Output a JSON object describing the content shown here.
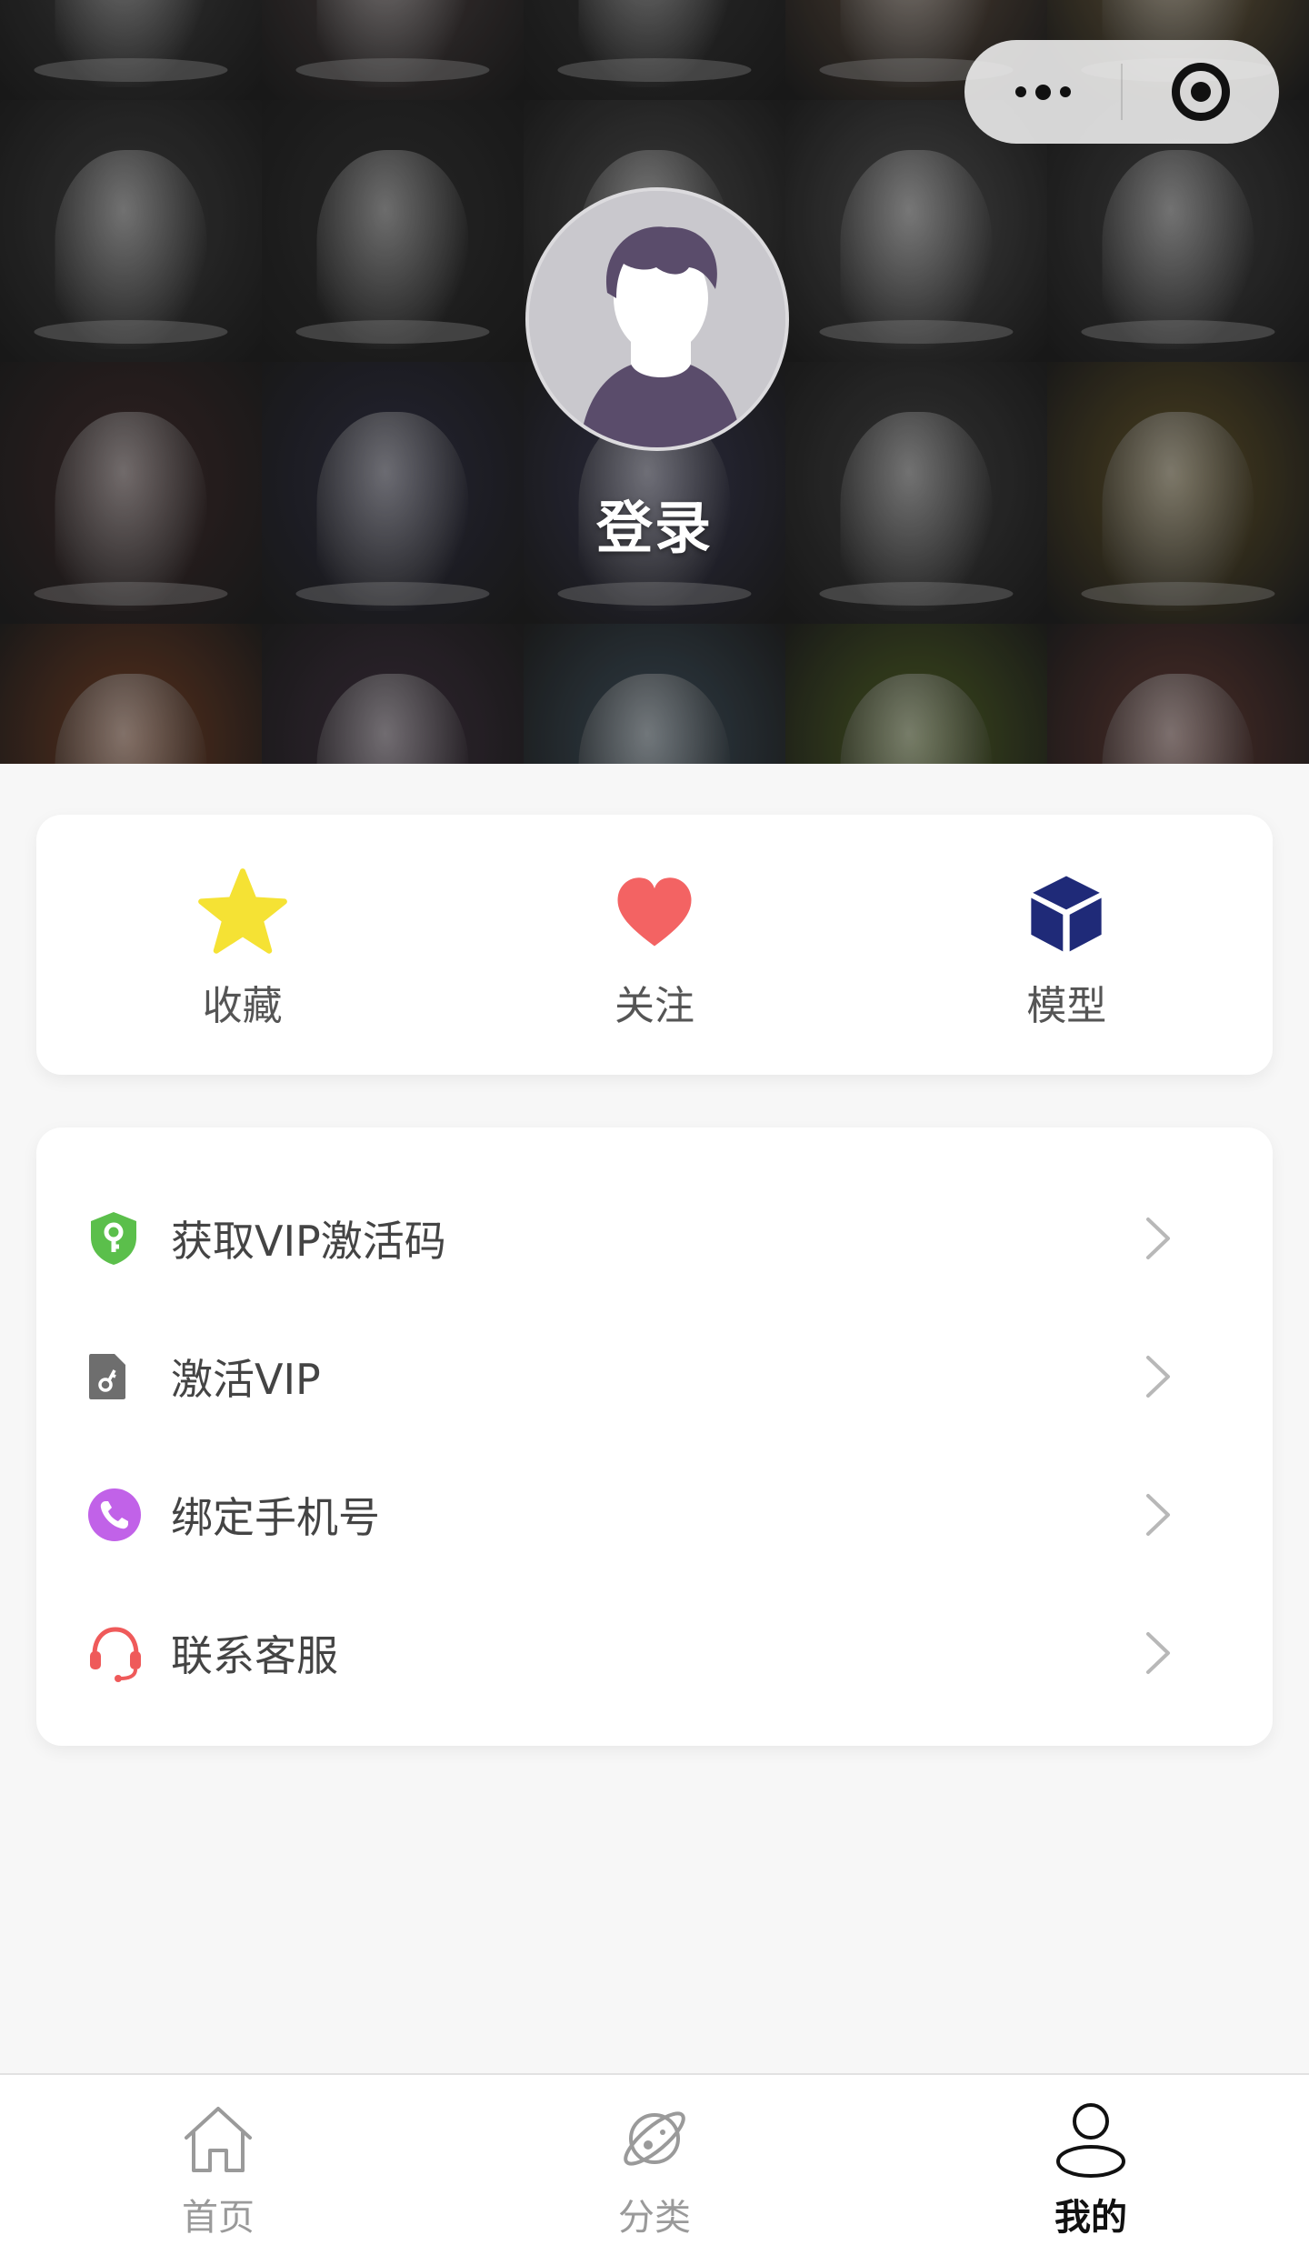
{
  "header": {
    "login_label": "登录",
    "tile_colors": [
      "#3b3b3b",
      "#473d3d",
      "#333333",
      "#5a4a3c",
      "#6a5a3a",
      "#3a3a3a",
      "#2e2e2e",
      "#454545",
      "#4a4a4a",
      "#3d3d3d",
      "#3a2828",
      "#2b2b3d",
      "#33334a",
      "#3c3c3c",
      "#5a4d26",
      "#6a3a22",
      "#3a2d3a",
      "#3a4a55",
      "#4a5a22",
      "#5a3530"
    ]
  },
  "capsule": {
    "more_icon": "more-dots-icon",
    "close_icon": "target-close-icon"
  },
  "quick_actions": [
    {
      "label": "收藏",
      "icon": "star-icon",
      "color": "#f5e234"
    },
    {
      "label": "关注",
      "icon": "heart-icon",
      "color": "#f36363"
    },
    {
      "label": "模型",
      "icon": "cube-icon",
      "color": "#1f2a78"
    }
  ],
  "menu": [
    {
      "label": "获取VIP激活码",
      "icon": "shield-key-icon",
      "color": "#5bbf4b"
    },
    {
      "label": "激活VIP",
      "icon": "document-key-icon",
      "color": "#6e6e6e"
    },
    {
      "label": "绑定手机号",
      "icon": "phone-icon",
      "color": "#c162e8"
    },
    {
      "label": "联系客服",
      "icon": "headset-icon",
      "color": "#ef5a5a"
    }
  ],
  "tabbar": {
    "tabs": [
      {
        "label": "首页",
        "icon": "home-icon",
        "active": false
      },
      {
        "label": "分类",
        "icon": "planet-icon",
        "active": false
      },
      {
        "label": "我的",
        "icon": "user-icon",
        "active": true
      }
    ]
  }
}
